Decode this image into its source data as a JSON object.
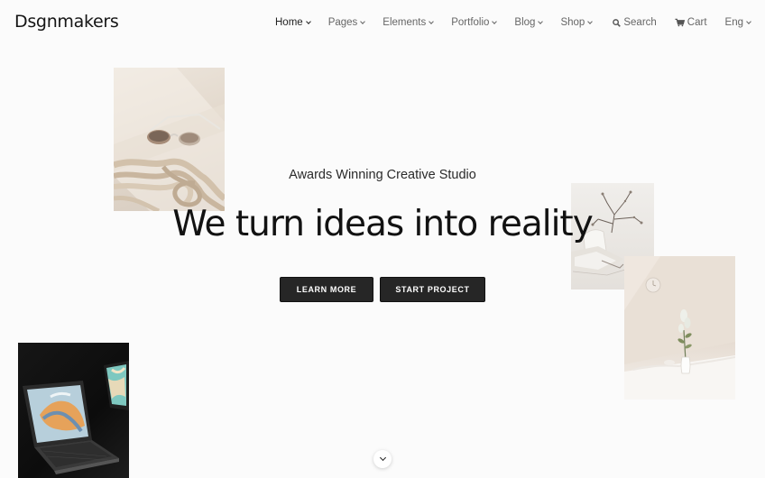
{
  "brand": {
    "logo": "Dsgnmakers"
  },
  "nav": {
    "items": [
      {
        "label": "Home",
        "active": true
      },
      {
        "label": "Pages"
      },
      {
        "label": "Elements"
      },
      {
        "label": "Portfolio"
      },
      {
        "label": "Blog"
      },
      {
        "label": "Shop"
      }
    ]
  },
  "utils": {
    "search": "Search",
    "cart": "Cart",
    "lang": "Eng"
  },
  "hero": {
    "tagline": "Awards Winning Creative Studio",
    "headline": "We turn ideas into reality",
    "learn_more": "LEARN MORE",
    "start_project": "START PROJECT"
  },
  "icons": {
    "search": "search-icon",
    "cart": "cart-icon",
    "chevron": "chevron-down-icon"
  },
  "colors": {
    "button_bg": "#262626",
    "background": "#fbfbfb"
  }
}
